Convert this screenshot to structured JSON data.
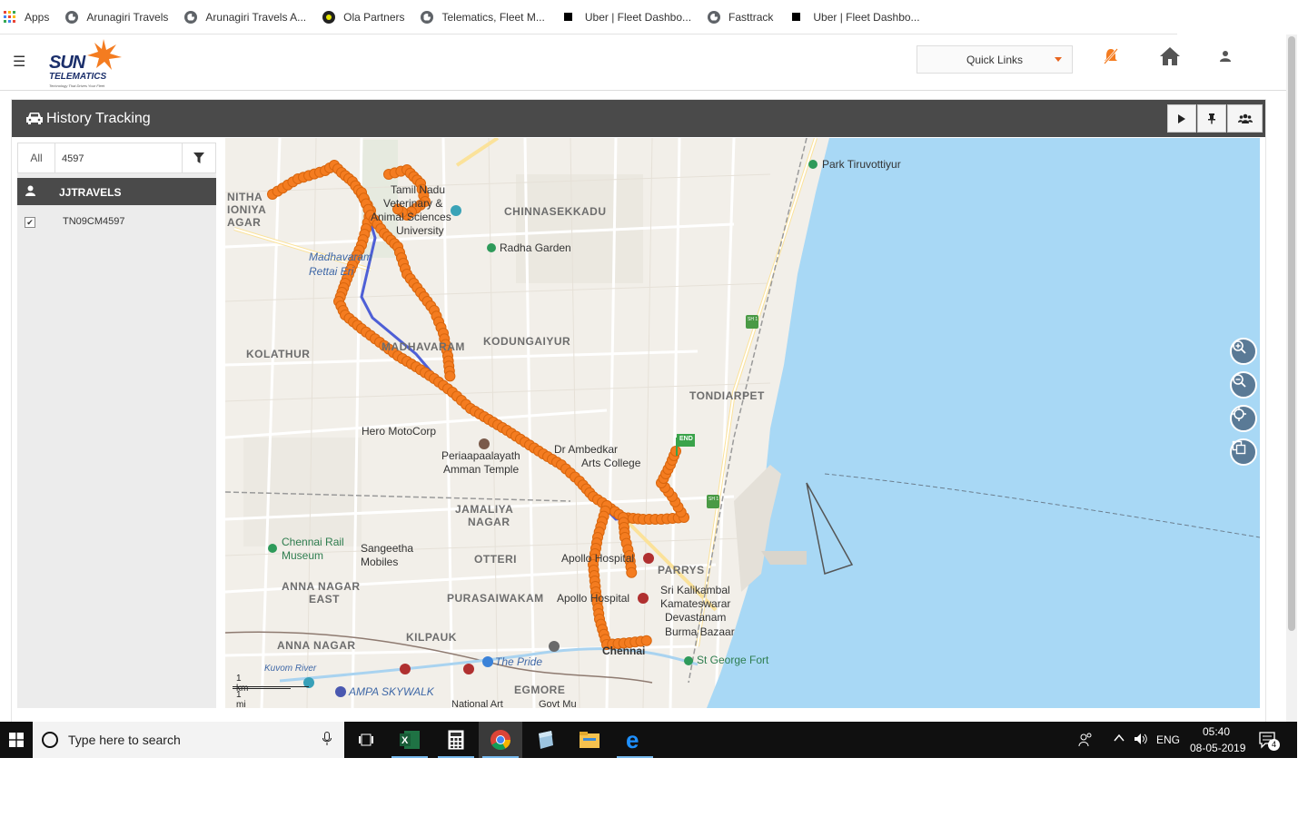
{
  "bookmarks": {
    "items": [
      {
        "label": "Apps",
        "icon": "apps-grid-icon"
      },
      {
        "label": "Arunagiri Travels",
        "icon": "globe-icon"
      },
      {
        "label": "Arunagiri Travels A...",
        "icon": "globe-icon"
      },
      {
        "label": "Ola Partners",
        "icon": "ola-icon"
      },
      {
        "label": "Telematics, Fleet M...",
        "icon": "globe-icon"
      },
      {
        "label": "Uber | Fleet Dashbo...",
        "icon": "uber-icon"
      },
      {
        "label": "Fasttrack",
        "icon": "globe-icon"
      },
      {
        "label": "Uber | Fleet Dashbo...",
        "icon": "uber-icon"
      }
    ]
  },
  "header": {
    "logo_main": "SUN",
    "logo_sub": "TELEMATICS",
    "logo_tagline": "Technology That Drives Your Fleet",
    "quick_links": "Quick Links"
  },
  "panel": {
    "title": "History Tracking",
    "buttons": [
      "play-icon",
      "pin-icon",
      "group-icon"
    ]
  },
  "sidebar": {
    "all_label": "All",
    "search_value": "4597",
    "group_name": "JJTRAVELS",
    "vehicles": [
      {
        "label": "TN09CM4597",
        "checked": true
      }
    ]
  },
  "map": {
    "labels": [
      {
        "text": "NITHA",
        "kind": "caps"
      },
      {
        "text": "IONIYA",
        "kind": "caps"
      },
      {
        "text": "AGAR",
        "kind": "caps"
      },
      {
        "text": "Tamil Nadu",
        "kind": "poi"
      },
      {
        "text": "Veterinary &",
        "kind": "poi"
      },
      {
        "text": "Animal Sciences",
        "kind": "poi"
      },
      {
        "text": "University",
        "kind": "poi"
      },
      {
        "text": "CHINNASEKKADU",
        "kind": "caps"
      },
      {
        "text": "Radha Garden",
        "kind": "poi"
      },
      {
        "text": "Park Tiruvottiyur",
        "kind": "poi"
      },
      {
        "text": "Madhavaram",
        "kind": "blue"
      },
      {
        "text": "Rettai Eri",
        "kind": "blue"
      },
      {
        "text": "KOLATHUR",
        "kind": "caps"
      },
      {
        "text": "MADHAVARAM",
        "kind": "caps"
      },
      {
        "text": "KODUNGAIYUR",
        "kind": "caps"
      },
      {
        "text": "TONDIARPET",
        "kind": "caps"
      },
      {
        "text": "Hero MotoCorp",
        "kind": "poi"
      },
      {
        "text": "Periaapaalayath",
        "kind": "poi"
      },
      {
        "text": "Amman Temple",
        "kind": "poi"
      },
      {
        "text": "Dr Ambedkar",
        "kind": "poi"
      },
      {
        "text": "Arts College",
        "kind": "poi"
      },
      {
        "text": "JAMALIYA",
        "kind": "caps"
      },
      {
        "text": "NAGAR",
        "kind": "caps"
      },
      {
        "text": "Chennai Rail",
        "kind": "green"
      },
      {
        "text": "Museum",
        "kind": "green"
      },
      {
        "text": "Sangeetha",
        "kind": "poi"
      },
      {
        "text": "Mobiles",
        "kind": "poi"
      },
      {
        "text": "OTTERI",
        "kind": "caps"
      },
      {
        "text": "Apollo Hospital",
        "kind": "poi"
      },
      {
        "text": "PARRYS",
        "kind": "caps"
      },
      {
        "text": "ANNA NAGAR",
        "kind": "caps"
      },
      {
        "text": "EAST",
        "kind": "caps"
      },
      {
        "text": "PURASAIWAKAM",
        "kind": "caps"
      },
      {
        "text": "Apollo Hospital",
        "kind": "poi"
      },
      {
        "text": "Sri Kalikambal",
        "kind": "poi"
      },
      {
        "text": "Kamateswarar",
        "kind": "poi"
      },
      {
        "text": "Devastanam",
        "kind": "poi"
      },
      {
        "text": "Burma Bazaar",
        "kind": "poi"
      },
      {
        "text": "ANNA NAGAR",
        "kind": "caps"
      },
      {
        "text": "KILPAUK",
        "kind": "caps"
      },
      {
        "text": "The Pride",
        "kind": "blue"
      },
      {
        "text": "Chennai",
        "kind": "poi"
      },
      {
        "text": "St George Fort",
        "kind": "green"
      },
      {
        "text": "Kuvom River",
        "kind": "blue"
      },
      {
        "text": "AMPA SKYWALK",
        "kind": "blue"
      },
      {
        "text": "EGMORE",
        "kind": "caps"
      },
      {
        "text": "National Art",
        "kind": "poi"
      },
      {
        "text": "Govt Mu",
        "kind": "poi"
      }
    ],
    "end_marker": "END",
    "route_marker": "SH 1",
    "scale_km": "1 km",
    "scale_mi": "1 mi",
    "controls": [
      "zoom-in-icon",
      "zoom-out-icon",
      "locate-icon",
      "layers-icon"
    ]
  },
  "taskbar": {
    "search_placeholder": "Type here to search",
    "apps": [
      "task-view-icon",
      "excel-icon",
      "calculator-icon",
      "chrome-icon",
      "notepad-icon",
      "file-explorer-icon",
      "edge-icon"
    ],
    "language": "ENG",
    "time": "05:40",
    "date": "08-05-2019",
    "notification_count": "4"
  },
  "colors": {
    "brand_orange": "#f47c20",
    "panel_dark": "#4a4a4a",
    "water": "#a8d8f5",
    "route_blue": "#4e5fd6"
  }
}
